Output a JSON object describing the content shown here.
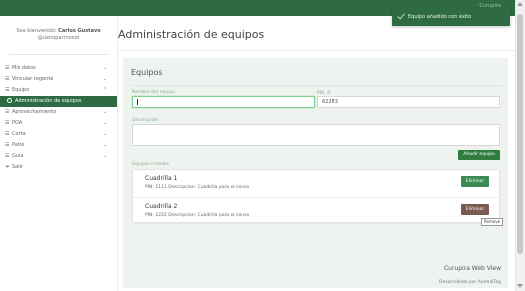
{
  "topbar": {
    "user_text": "Curupira"
  },
  "sidebar": {
    "welcome_prefix": "Sea bienvenido",
    "user_name": "Carlos Gustavo",
    "user_handle": "@uenoparrnoool",
    "items": [
      {
        "label": "Mis datos",
        "icon": "list-icon",
        "has_chevron": true
      },
      {
        "label": "Vincular regente",
        "icon": "list-icon",
        "has_chevron": true
      },
      {
        "label": "Equipo",
        "icon": "list-icon",
        "has_chevron": true
      },
      {
        "label": "Administración de equipos",
        "icon": "ring-icon",
        "active": true
      },
      {
        "label": "Aprovechamiento",
        "icon": "list-icon",
        "has_chevron": true
      },
      {
        "label": "POA",
        "icon": "list-icon",
        "has_chevron": true
      },
      {
        "label": "Corta",
        "icon": "list-icon",
        "has_chevron": true
      },
      {
        "label": "Patio",
        "icon": "list-icon",
        "has_chevron": true
      },
      {
        "label": "Guía",
        "icon": "list-icon",
        "has_chevron": true
      },
      {
        "label": "Salir",
        "icon": "logout-icon",
        "has_chevron": false
      }
    ]
  },
  "main": {
    "page_title": "Administración de equipos",
    "card_title": "Equipos",
    "form": {
      "name_label": "Nombre del equipo",
      "name_value": "",
      "pin_label": "PIN",
      "pin_value": "62283",
      "desc_label": "Descripción",
      "desc_value": "",
      "add_button": "Añadir equipo"
    },
    "list_label": "Equipos creados",
    "teams": [
      {
        "name": "Cuadrilla 1",
        "pin": "1111",
        "description": "Cuadrilla para el censo",
        "delete_label": "Eliminar"
      },
      {
        "name": "Cuadrilla 2",
        "pin": "2222",
        "description": "Cuadrilla para el censo",
        "delete_label": "Eliminar"
      }
    ],
    "pin_prefix": "PIN:",
    "desc_prefix": "Descripcion:",
    "tooltip": "Remove",
    "brand": "Curupira Web View",
    "developer": "Desarrollado por AnimalTag"
  },
  "toast": {
    "message": "Equipo añadido con éxito"
  },
  "colors": {
    "primary": "#2e6b42",
    "button_green": "#3d8a55",
    "button_brown": "#7a5a4e"
  }
}
